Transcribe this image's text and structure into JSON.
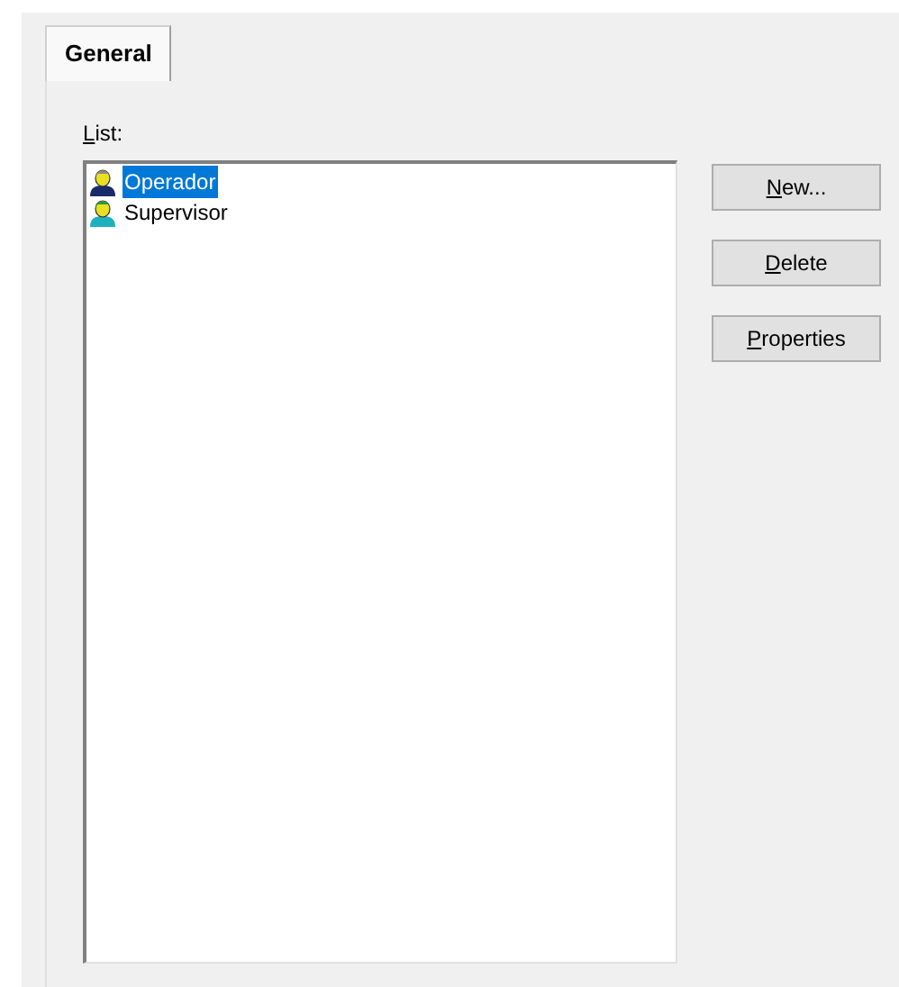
{
  "tabs": [
    {
      "label": "General",
      "selected": true
    }
  ],
  "list": {
    "label": "List:",
    "mnemonic_underlined": true,
    "items": [
      {
        "label": "Operador",
        "selected": true,
        "kind": "operator"
      },
      {
        "label": "Supervisor",
        "selected": false,
        "kind": "supervisor"
      }
    ]
  },
  "buttons": [
    {
      "label": "New...",
      "mnemonic_underlined": true
    },
    {
      "label": "Delete",
      "mnemonic_underlined": true
    },
    {
      "label": "Properties",
      "mnemonic_underlined": true
    }
  ]
}
